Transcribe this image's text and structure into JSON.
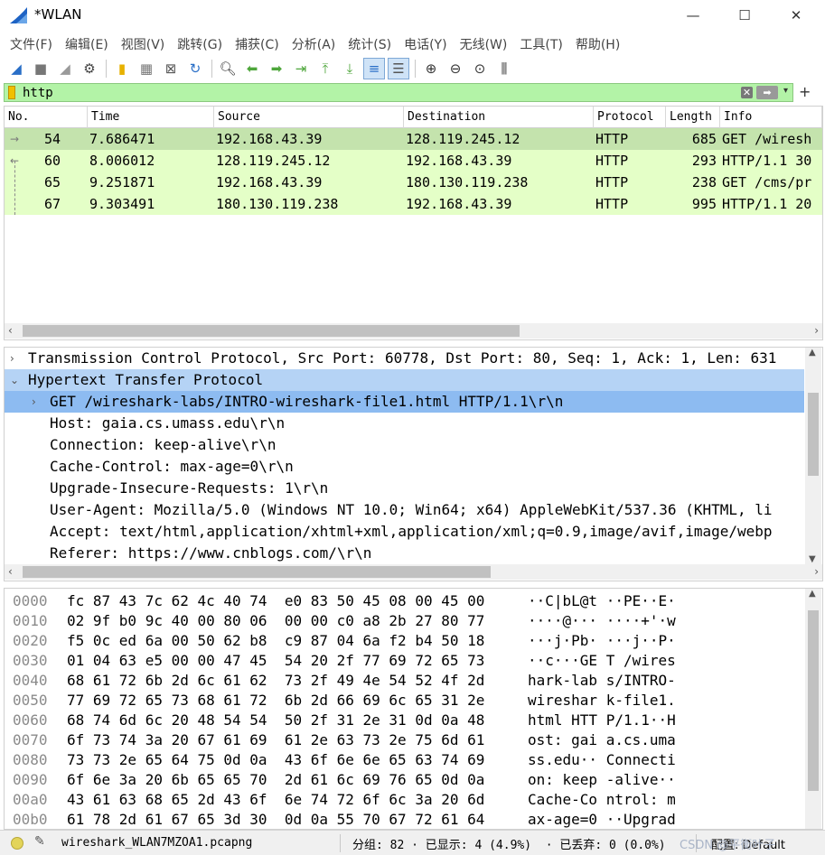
{
  "window": {
    "title": "*WLAN",
    "min": "—",
    "max": "☐",
    "close": "✕"
  },
  "menu": [
    "文件(F)",
    "编辑(E)",
    "视图(V)",
    "跳转(G)",
    "捕获(C)",
    "分析(A)",
    "统计(S)",
    "电话(Y)",
    "无线(W)",
    "工具(T)",
    "帮助(H)"
  ],
  "toolbar": {
    "icons": [
      {
        "name": "start-capture-icon",
        "glyph": "◢",
        "color": "#2a6fc7"
      },
      {
        "name": "stop-capture-icon",
        "glyph": "■",
        "color": "#777777"
      },
      {
        "name": "restart-capture-icon",
        "glyph": "◢",
        "color": "#9a9a9a"
      },
      {
        "name": "capture-options-icon",
        "glyph": "⚙",
        "color": "#444444"
      },
      {
        "sep": true
      },
      {
        "name": "open-file-icon",
        "glyph": "▮",
        "color": "#e7b100"
      },
      {
        "name": "save-file-icon",
        "glyph": "▦",
        "color": "#777777"
      },
      {
        "name": "close-file-icon",
        "glyph": "⊠",
        "color": "#555555"
      },
      {
        "name": "reload-file-icon",
        "glyph": "↻",
        "color": "#2a6fc7"
      },
      {
        "sep": true
      },
      {
        "name": "find-packet-icon",
        "glyph": "🔍︎",
        "color": "#333333"
      },
      {
        "name": "go-back-icon",
        "glyph": "⬅",
        "color": "#4ea63b"
      },
      {
        "name": "go-forward-icon",
        "glyph": "➡",
        "color": "#4ea63b"
      },
      {
        "name": "go-to-packet-icon",
        "glyph": "⇥",
        "color": "#4ea63b"
      },
      {
        "name": "go-first-packet-icon",
        "glyph": "⤒",
        "color": "#4ea63b"
      },
      {
        "name": "go-last-packet-icon",
        "glyph": "⤓",
        "color": "#4ea63b"
      },
      {
        "name": "autoscroll-icon",
        "glyph": "≡",
        "color": "#2a6fc7",
        "active": true
      },
      {
        "name": "colorize-icon",
        "glyph": "☰",
        "color": "#555555",
        "active": true
      },
      {
        "sep": true
      },
      {
        "name": "zoom-in-icon",
        "glyph": "⊕",
        "color": "#333333"
      },
      {
        "name": "zoom-out-icon",
        "glyph": "⊖",
        "color": "#333333"
      },
      {
        "name": "zoom-normal-icon",
        "glyph": "⊙",
        "color": "#333333"
      },
      {
        "name": "resize-columns-icon",
        "glyph": "⫼",
        "color": "#333333"
      }
    ]
  },
  "filter": {
    "value": "http",
    "clear": "✕",
    "apply": "➡",
    "dropdown": "▾",
    "add": "+"
  },
  "packet_list": {
    "columns": [
      "No.",
      "Time",
      "Source",
      "Destination",
      "Protocol",
      "Length",
      "Info"
    ],
    "rows": [
      {
        "no": "54",
        "time": "7.686471",
        "source": "192.168.43.39",
        "destination": "128.119.245.12",
        "protocol": "HTTP",
        "length": "685",
        "info": "GET /wiresh",
        "selected": true,
        "rel": "→"
      },
      {
        "no": "60",
        "time": "8.006012",
        "source": "128.119.245.12",
        "destination": "192.168.43.39",
        "protocol": "HTTP",
        "length": "293",
        "info": "HTTP/1.1 30",
        "selected": false,
        "rel": "←"
      },
      {
        "no": "65",
        "time": "9.251871",
        "source": "192.168.43.39",
        "destination": "180.130.119.238",
        "protocol": "HTTP",
        "length": "238",
        "info": "GET /cms/pr",
        "selected": false,
        "rel": ""
      },
      {
        "no": "67",
        "time": "9.303491",
        "source": "180.130.119.238",
        "destination": "192.168.43.39",
        "protocol": "HTTP",
        "length": "995",
        "info": "HTTP/1.1 20",
        "selected": false,
        "rel": ""
      }
    ]
  },
  "details": [
    {
      "caret": "›",
      "indent": 0,
      "text": "Transmission Control Protocol, Src Port: 60778, Dst Port: 80, Seq: 1, Ack: 1, Len: 631",
      "state": ""
    },
    {
      "caret": "⌄",
      "indent": 0,
      "text": "Hypertext Transfer Protocol",
      "state": "header-sel"
    },
    {
      "caret": "›",
      "indent": 1,
      "text": "GET /wireshark-labs/INTRO-wireshark-file1.html HTTP/1.1\\r\\n",
      "state": "selected"
    },
    {
      "caret": "",
      "indent": 1,
      "text": "Host: gaia.cs.umass.edu\\r\\n",
      "state": ""
    },
    {
      "caret": "",
      "indent": 1,
      "text": "Connection: keep-alive\\r\\n",
      "state": ""
    },
    {
      "caret": "",
      "indent": 1,
      "text": "Cache-Control: max-age=0\\r\\n",
      "state": ""
    },
    {
      "caret": "",
      "indent": 1,
      "text": "Upgrade-Insecure-Requests: 1\\r\\n",
      "state": ""
    },
    {
      "caret": "",
      "indent": 1,
      "text": "User-Agent: Mozilla/5.0 (Windows NT 10.0; Win64; x64) AppleWebKit/537.36 (KHTML, li",
      "state": ""
    },
    {
      "caret": "",
      "indent": 1,
      "text": "Accept: text/html,application/xhtml+xml,application/xml;q=0.9,image/avif,image/webp",
      "state": ""
    },
    {
      "caret": "",
      "indent": 1,
      "text": "Referer: https://www.cnblogs.com/\\r\\n",
      "state": ""
    }
  ],
  "bytes": [
    {
      "offset": "0000",
      "hex": "fc 87 43 7c 62 4c 40 74  e0 83 50 45 08 00 45 00",
      "ascii": "··C|bL@t ··PE··E·"
    },
    {
      "offset": "0010",
      "hex": "02 9f b0 9c 40 00 80 06  00 00 c0 a8 2b 27 80 77",
      "ascii": "····@··· ····+'·w"
    },
    {
      "offset": "0020",
      "hex": "f5 0c ed 6a 00 50 62 b8  c9 87 04 6a f2 b4 50 18",
      "ascii": "···j·Pb· ···j··P·"
    },
    {
      "offset": "0030",
      "hex": "01 04 63 e5 00 00 47 45  54 20 2f 77 69 72 65 73",
      "ascii": "··c···GE T /wires"
    },
    {
      "offset": "0040",
      "hex": "68 61 72 6b 2d 6c 61 62  73 2f 49 4e 54 52 4f 2d",
      "ascii": "hark-lab s/INTRO-"
    },
    {
      "offset": "0050",
      "hex": "77 69 72 65 73 68 61 72  6b 2d 66 69 6c 65 31 2e",
      "ascii": "wireshar k-file1."
    },
    {
      "offset": "0060",
      "hex": "68 74 6d 6c 20 48 54 54  50 2f 31 2e 31 0d 0a 48",
      "ascii": "html HTT P/1.1··H"
    },
    {
      "offset": "0070",
      "hex": "6f 73 74 3a 20 67 61 69  61 2e 63 73 2e 75 6d 61",
      "ascii": "ost: gai a.cs.uma"
    },
    {
      "offset": "0080",
      "hex": "73 73 2e 65 64 75 0d 0a  43 6f 6e 6e 65 63 74 69",
      "ascii": "ss.edu·· Connecti"
    },
    {
      "offset": "0090",
      "hex": "6f 6e 3a 20 6b 65 65 70  2d 61 6c 69 76 65 0d 0a",
      "ascii": "on: keep -alive··"
    },
    {
      "offset": "00a0",
      "hex": "43 61 63 68 65 2d 43 6f  6e 74 72 6f 6c 3a 20 6d",
      "ascii": "Cache-Co ntrol: m"
    },
    {
      "offset": "00b0",
      "hex": "61 78 2d 61 67 65 3d 30  0d 0a 55 70 67 72 61 64",
      "ascii": "ax-age=0 ··Upgrad"
    }
  ],
  "status": {
    "file": "wireshark_WLAN7MZOA1.pcapng",
    "stats": "分组: 82 · 已显示: 4 (4.9%)  · 已丢弃: 0 (0.0%)",
    "profile": "配置: Default",
    "watermark": "CSDN @平衡叶子"
  },
  "colors": {
    "filter_valid": "#b3f3a7",
    "row_http": "#e4ffc7",
    "row_selected": "#c4e3ad",
    "detail_selected": "#8dbbf1"
  }
}
